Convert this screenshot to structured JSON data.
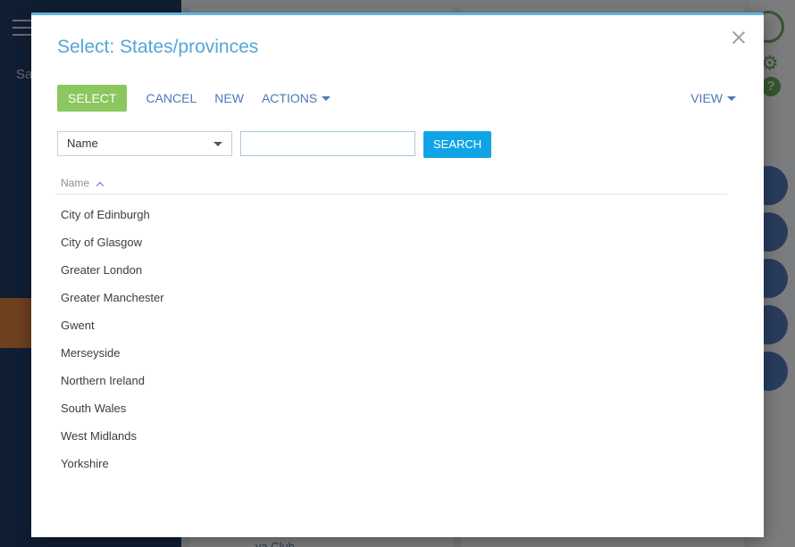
{
  "background": {
    "sidebar_label": "Sa",
    "link_text": "...ya Club"
  },
  "dialog": {
    "title": "Select: States/provinces",
    "toolbar": {
      "select_label": "SELECT",
      "cancel_label": "CANCEL",
      "new_label": "NEW",
      "actions_label": "ACTIONS",
      "view_label": "VIEW"
    },
    "filter": {
      "field_value": "Name",
      "search_value": "",
      "search_button": "SEARCH"
    },
    "column_header": "Name",
    "rows": [
      "City of Edinburgh",
      "City of Glasgow",
      "Greater London",
      "Greater Manchester",
      "Gwent",
      "Merseyside",
      "Northern Ireland",
      "South Wales",
      "West Midlands",
      "Yorkshire"
    ]
  },
  "colors": {
    "title": "#55a5d7",
    "select_button": "#8bc65e",
    "search_button": "#10a4e6",
    "link": "#4d78b7"
  }
}
